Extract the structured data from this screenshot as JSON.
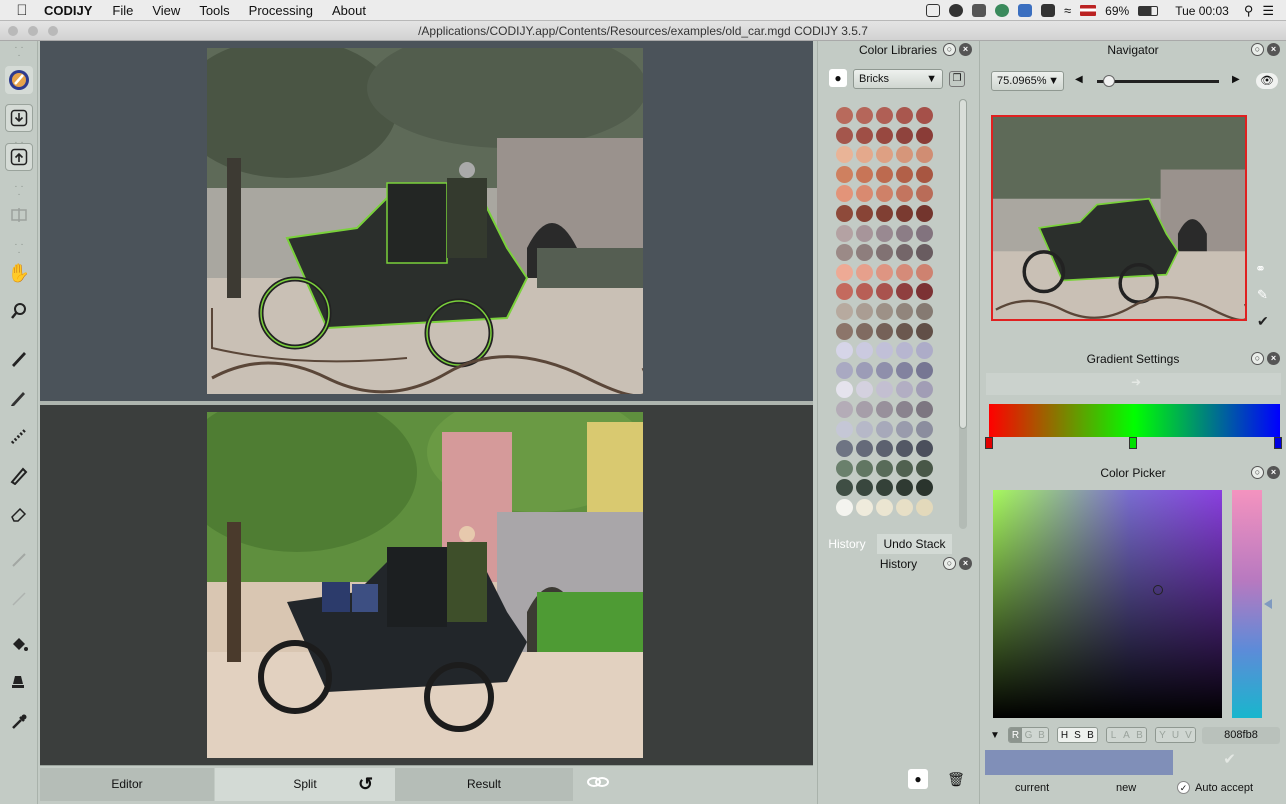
{
  "menubar": {
    "app_name": "CODIJY",
    "items": [
      "File",
      "View",
      "Tools",
      "Processing",
      "About"
    ],
    "battery": "69%",
    "clock": "Tue 00:03"
  },
  "window": {
    "title": "/Applications/CODIJY.app/Contents/Resources/examples/old_car.mgd CODIJY 3.5.7"
  },
  "bottom_bar": {
    "editor_label": "Editor",
    "split_label": "Split",
    "result_label": "Result"
  },
  "color_libraries": {
    "title": "Color Libraries",
    "library_select": "Bricks",
    "swatches": [
      [
        "#b86a5c",
        "#b5665a",
        "#b05f55",
        "#a9574e",
        "#a55049"
      ],
      [
        "#a4564c",
        "#9f4f46",
        "#984840",
        "#8f433d",
        "#8a3c37"
      ],
      [
        "#e9b497",
        "#e4a98c",
        "#dea083",
        "#d6967a",
        "#d08d73"
      ],
      [
        "#cf805f",
        "#c87557",
        "#bd6a4f",
        "#b26048",
        "#a85641"
      ],
      [
        "#e39479",
        "#d98a70",
        "#cf8168",
        "#c3755f",
        "#b96c58"
      ],
      [
        "#8e4a3a",
        "#884436",
        "#803f33",
        "#7a3a30",
        "#73352d"
      ],
      [
        "#b4a2a3",
        "#a7959a",
        "#998991",
        "#8c7d86",
        "#82737e"
      ],
      [
        "#9b8a87",
        "#8e7e7d",
        "#817273",
        "#746669",
        "#695c60"
      ],
      [
        "#eeaa95",
        "#e6a08c",
        "#de9582",
        "#d58b79",
        "#ce8270"
      ],
      [
        "#c46a5e",
        "#b85f56",
        "#a9534e",
        "#8f3f3f",
        "#7c3234"
      ],
      [
        "#b7aa9f",
        "#aa9d93",
        "#9d9187",
        "#91857c",
        "#857a72"
      ],
      [
        "#8c756a",
        "#806b61",
        "#756158",
        "#6b584f",
        "#614f47"
      ],
      [
        "#d6d5e8",
        "#cbcae0",
        "#c1c0d8",
        "#b7b6d0",
        "#adacc8"
      ],
      [
        "#a9a9c2",
        "#9c9cb7",
        "#8f8fab",
        "#82829f",
        "#767693"
      ],
      [
        "#e5e3ed",
        "#d4d1df",
        "#c3bfd1",
        "#b2aec3",
        "#a19db5"
      ],
      [
        "#b4acb7",
        "#a69ea9",
        "#98909b",
        "#8a838e",
        "#7d7681"
      ],
      [
        "#c5c7d6",
        "#b6b8c8",
        "#a7a9ba",
        "#999bac",
        "#8b8d9e"
      ],
      [
        "#6e7483",
        "#656a79",
        "#5c616f",
        "#535865",
        "#4b4f5c"
      ],
      [
        "#6a806c",
        "#617662",
        "#586b59",
        "#506150",
        "#485747"
      ],
      [
        "#3f4e44",
        "#39473e",
        "#344138",
        "#2f3a32",
        "#2a342d"
      ],
      [
        "#f4f4ef",
        "#efebdc",
        "#ebe5d1",
        "#e7dfc6",
        "#e3d9bb"
      ]
    ]
  },
  "history": {
    "tab_history": "History",
    "tab_undo": "Undo Stack",
    "subpanel_title": "History"
  },
  "navigator": {
    "title": "Navigator",
    "zoom": "75.0965%",
    "slider_value": 0.05
  },
  "gradient": {
    "title": "Gradient Settings",
    "stops": [
      "#ff0000",
      "#00ff00",
      "#0000ff"
    ]
  },
  "picker": {
    "title": "Color Picker",
    "mode_buttons": [
      "R",
      "G",
      "B",
      "H",
      "S",
      "B",
      "L",
      "A",
      "B",
      "Y",
      "U",
      "V"
    ],
    "hex": "808fb8",
    "current_color": "#808fb8",
    "current_label": "current",
    "new_label": "new",
    "auto_accept_label": "Auto accept"
  }
}
